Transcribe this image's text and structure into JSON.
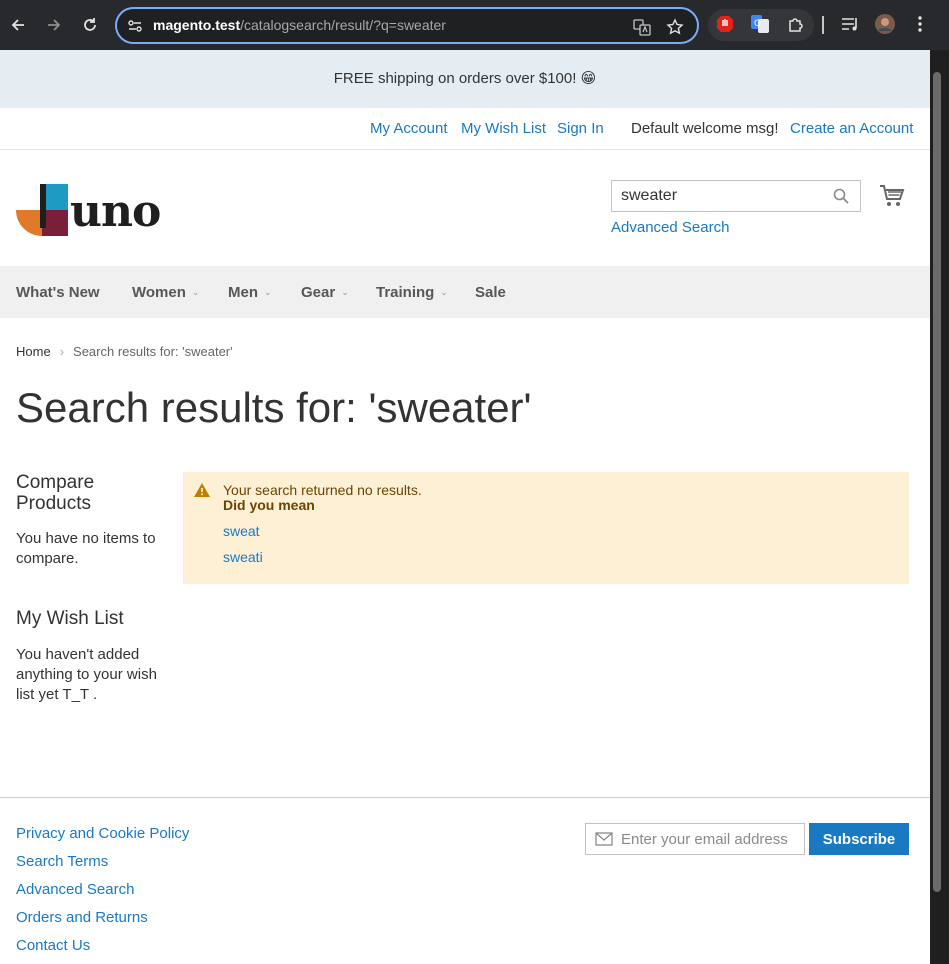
{
  "browser": {
    "url_domain": "magento.test",
    "url_path": "/catalogsearch/result/?q=sweater"
  },
  "promo": {
    "text": "FREE shipping on orders over $100! 😁"
  },
  "header": {
    "links": {
      "my_account": "My Account",
      "wish_list": "My Wish List",
      "sign_in": "Sign In",
      "welcome": "Default welcome msg!",
      "create_account": "Create an Account"
    }
  },
  "logo": {
    "text": "uno"
  },
  "search": {
    "value": "sweater",
    "advanced_label": "Advanced Search"
  },
  "nav": {
    "items": [
      {
        "label": "What's New"
      },
      {
        "label": "Women"
      },
      {
        "label": "Men"
      },
      {
        "label": "Gear"
      },
      {
        "label": "Training"
      },
      {
        "label": "Sale"
      }
    ]
  },
  "breadcrumb": {
    "home": "Home",
    "current": "Search results for: 'sweater'"
  },
  "main": {
    "title": "Search results for: 'sweater'",
    "notice": {
      "message": "Your search returned no results.",
      "did_you_mean": "Did you mean",
      "suggestions": [
        "sweat",
        "sweati"
      ]
    }
  },
  "sidebar": {
    "compare_heading_line1": "Compare",
    "compare_heading_line2": "Products",
    "compare_text": "You have no items to compare.",
    "wishlist_heading": "My Wish List",
    "wishlist_text": "You haven't added anything to your wish list yet T_T ."
  },
  "footer": {
    "links": [
      "Privacy and Cookie Policy",
      "Search Terms",
      "Advanced Search",
      "Orders and Returns",
      "Contact Us"
    ],
    "newsletter_placeholder": "Enter your email address",
    "subscribe_label": "Subscribe"
  },
  "colors": {
    "link": "#1979c3",
    "promo_bg": "#e5edf3",
    "notice_bg": "#fdf0d5",
    "notice_text": "#6f4400",
    "nav_bg": "#f0f0f0"
  }
}
